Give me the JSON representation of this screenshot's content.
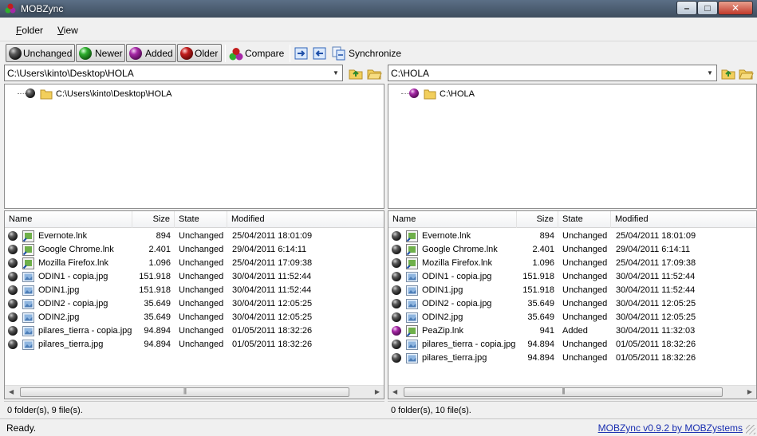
{
  "window": {
    "title": "MOBZync"
  },
  "menu": [
    {
      "prefix": "",
      "underline": "F",
      "rest": "older"
    },
    {
      "prefix": "",
      "underline": "V",
      "rest": "iew"
    }
  ],
  "toolbar": {
    "unchanged": "Unchanged",
    "newer": "Newer",
    "added": "Added",
    "older": "Older",
    "compare": "Compare",
    "synchronize": "Synchronize"
  },
  "left": {
    "path": "C:\\Users\\kinto\\Desktop\\HOLA",
    "tree_root": "C:\\Users\\kinto\\Desktop\\HOLA",
    "tree_state_color": "#111111",
    "columns": [
      "Name",
      "Size",
      "State",
      "Modified"
    ],
    "files": [
      {
        "state_color": "black",
        "icon": "shortcut-icon",
        "name": "Evernote.lnk",
        "size": "894",
        "state": "Unchanged",
        "modified": "25/04/2011 18:01:09"
      },
      {
        "state_color": "black",
        "icon": "shortcut-icon",
        "name": "Google Chrome.lnk",
        "size": "2.401",
        "state": "Unchanged",
        "modified": "29/04/2011 6:14:11"
      },
      {
        "state_color": "black",
        "icon": "shortcut-icon",
        "name": "Mozilla Firefox.lnk",
        "size": "1.096",
        "state": "Unchanged",
        "modified": "25/04/2011 17:09:38"
      },
      {
        "state_color": "black",
        "icon": "image-icon",
        "name": "ODIN1 - copia.jpg",
        "size": "151.918",
        "state": "Unchanged",
        "modified": "30/04/2011 11:52:44"
      },
      {
        "state_color": "black",
        "icon": "image-icon",
        "name": "ODIN1.jpg",
        "size": "151.918",
        "state": "Unchanged",
        "modified": "30/04/2011 11:52:44"
      },
      {
        "state_color": "black",
        "icon": "image-icon",
        "name": "ODIN2 - copia.jpg",
        "size": "35.649",
        "state": "Unchanged",
        "modified": "30/04/2011 12:05:25"
      },
      {
        "state_color": "black",
        "icon": "image-icon",
        "name": "ODIN2.jpg",
        "size": "35.649",
        "state": "Unchanged",
        "modified": "30/04/2011 12:05:25"
      },
      {
        "state_color": "black",
        "icon": "image-icon",
        "name": "pilares_tierra - copia.jpg",
        "size": "94.894",
        "state": "Unchanged",
        "modified": "01/05/2011 18:32:26"
      },
      {
        "state_color": "black",
        "icon": "image-icon",
        "name": "pilares_tierra.jpg",
        "size": "94.894",
        "state": "Unchanged",
        "modified": "01/05/2011 18:32:26"
      }
    ],
    "status": "0 folder(s), 9 file(s)."
  },
  "right": {
    "path": "C:\\HOLA",
    "tree_root": "C:\\HOLA",
    "columns": [
      "Name",
      "Size",
      "State",
      "Modified"
    ],
    "files": [
      {
        "state_color": "black",
        "icon": "shortcut-icon",
        "name": "Evernote.lnk",
        "size": "894",
        "state": "Unchanged",
        "modified": "25/04/2011 18:01:09"
      },
      {
        "state_color": "black",
        "icon": "shortcut-icon",
        "name": "Google Chrome.lnk",
        "size": "2.401",
        "state": "Unchanged",
        "modified": "29/04/2011 6:14:11"
      },
      {
        "state_color": "black",
        "icon": "shortcut-icon",
        "name": "Mozilla Firefox.lnk",
        "size": "1.096",
        "state": "Unchanged",
        "modified": "25/04/2011 17:09:38"
      },
      {
        "state_color": "black",
        "icon": "image-icon",
        "name": "ODIN1 - copia.jpg",
        "size": "151.918",
        "state": "Unchanged",
        "modified": "30/04/2011 11:52:44"
      },
      {
        "state_color": "black",
        "icon": "image-icon",
        "name": "ODIN1.jpg",
        "size": "151.918",
        "state": "Unchanged",
        "modified": "30/04/2011 11:52:44"
      },
      {
        "state_color": "black",
        "icon": "image-icon",
        "name": "ODIN2 - copia.jpg",
        "size": "35.649",
        "state": "Unchanged",
        "modified": "30/04/2011 12:05:25"
      },
      {
        "state_color": "black",
        "icon": "image-icon",
        "name": "ODIN2.jpg",
        "size": "35.649",
        "state": "Unchanged",
        "modified": "30/04/2011 12:05:25"
      },
      {
        "state_color": "purple",
        "icon": "shortcut-icon",
        "name": "PeaZip.lnk",
        "size": "941",
        "state": "Added",
        "modified": "30/04/2011 11:32:03"
      },
      {
        "state_color": "black",
        "icon": "image-icon",
        "name": "pilares_tierra - copia.jpg",
        "size": "94.894",
        "state": "Unchanged",
        "modified": "01/05/2011 18:32:26"
      },
      {
        "state_color": "black",
        "icon": "image-icon",
        "name": "pilares_tierra.jpg",
        "size": "94.894",
        "state": "Unchanged",
        "modified": "01/05/2011 18:32:26"
      }
    ],
    "status": "0 folder(s), 10 file(s)."
  },
  "statusbar": {
    "ready": "Ready.",
    "link": "MOBZync v0.9.2 by MOBZystems"
  },
  "colors": {
    "titlebar": "#4a5b6e",
    "link": "#1a2fb0",
    "added": "#a629a6"
  }
}
